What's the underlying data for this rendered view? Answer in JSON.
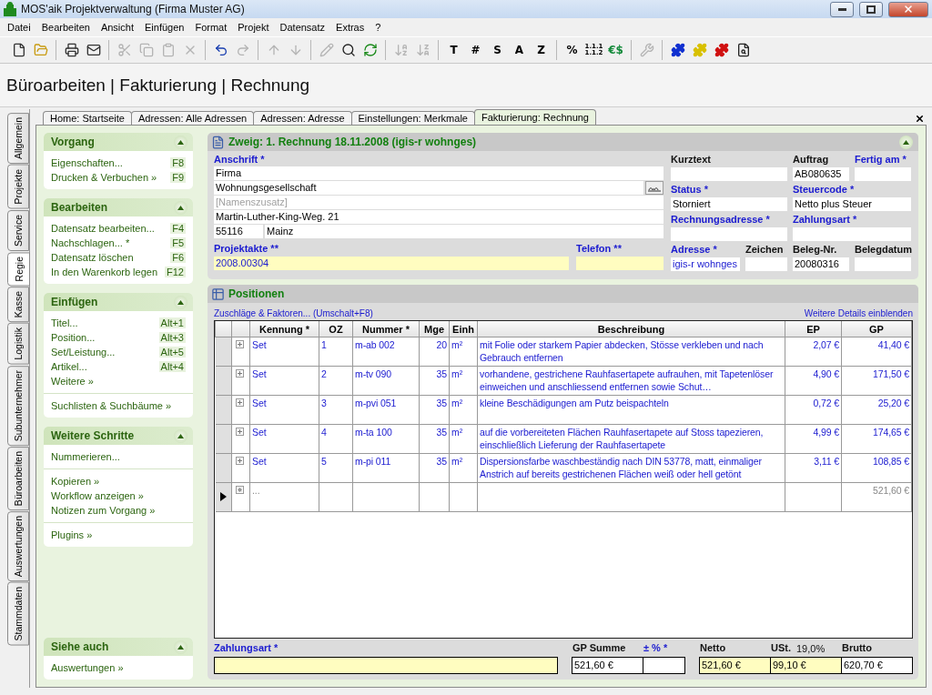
{
  "window": {
    "title": "MOS'aik Projektverwaltung (Firma Muster AG)"
  },
  "menu": [
    "Datei",
    "Bearbeiten",
    "Ansicht",
    "Einfügen",
    "Format",
    "Projekt",
    "Datensatz",
    "Extras",
    "?"
  ],
  "toolbar": [
    [
      {
        "kind": "icon",
        "disabled": false
      },
      {
        "kind": "icon",
        "disabled": false
      }
    ],
    [
      {
        "kind": "icon",
        "disabled": false
      },
      {
        "kind": "icon",
        "disabled": false
      }
    ],
    [
      {
        "kind": "icon",
        "disabled": true
      },
      {
        "kind": "icon",
        "disabled": true
      },
      {
        "kind": "icon",
        "disabled": true
      },
      {
        "kind": "icon",
        "disabled": true
      }
    ],
    [
      {
        "kind": "icon",
        "disabled": false
      },
      {
        "kind": "icon",
        "disabled": true
      }
    ],
    [
      {
        "kind": "icon",
        "disabled": true
      },
      {
        "kind": "icon",
        "disabled": true
      }
    ],
    [
      {
        "kind": "icon",
        "disabled": true
      },
      {
        "kind": "icon",
        "disabled": false
      },
      {
        "kind": "icon",
        "disabled": false
      }
    ],
    [
      {
        "kind": "icon",
        "disabled": true
      },
      {
        "kind": "icon",
        "disabled": true
      }
    ],
    [
      {
        "kind": "text",
        "label": "T"
      },
      {
        "kind": "text",
        "label": "#"
      },
      {
        "kind": "text",
        "label": "S"
      },
      {
        "kind": "text",
        "label": "A"
      },
      {
        "kind": "text",
        "label": "Z"
      }
    ],
    [
      {
        "kind": "text",
        "label": "%"
      },
      {
        "kind": "text",
        "label": "1.1.1\n1.1.2"
      },
      {
        "kind": "text",
        "label": "€$"
      }
    ],
    [
      {
        "kind": "icon",
        "disabled": true
      }
    ],
    [
      {
        "kind": "icon",
        "disabled": false
      },
      {
        "kind": "icon",
        "disabled": false
      },
      {
        "kind": "icon",
        "disabled": false
      },
      {
        "kind": "icon",
        "disabled": false
      }
    ]
  ],
  "page_title": "Büroarbeiten | Fakturierung | Rechnung",
  "side_tabs": [
    {
      "label": "Allgemein",
      "selected": false
    },
    {
      "label": "Projekte",
      "selected": false
    },
    {
      "label": "Service",
      "selected": false
    },
    {
      "label": "Regie",
      "selected": true
    },
    {
      "label": "Kasse",
      "selected": false
    },
    {
      "label": "Logistik",
      "selected": false
    },
    {
      "label": "Subunternehmer",
      "selected": false
    },
    {
      "label": "Büroarbeiten",
      "selected": false
    },
    {
      "label": "Auswertungen",
      "selected": false
    },
    {
      "label": "Stammdaten",
      "selected": false
    }
  ],
  "doc_tabs": [
    {
      "label": "Home: Startseite",
      "selected": false
    },
    {
      "label": "Adressen: Alle Adressen",
      "selected": false
    },
    {
      "label": "Adressen: Adresse",
      "selected": false
    },
    {
      "label": "Einstellungen: Merkmale",
      "selected": false
    },
    {
      "label": "Fakturierung: Rechnung",
      "selected": true
    }
  ],
  "task_panel": {
    "sections": [
      {
        "title": "Vorgang",
        "groups": [
          [
            {
              "label": "Eigenschaften...",
              "shortcut": "F8"
            },
            {
              "label": "Drucken & Verbuchen »",
              "shortcut": "F9"
            }
          ]
        ]
      },
      {
        "title": "Bearbeiten",
        "groups": [
          [
            {
              "label": "Datensatz bearbeiten...",
              "shortcut": "F4"
            },
            {
              "label": "Nachschlagen... *",
              "shortcut": "F5"
            },
            {
              "label": "Datensatz löschen",
              "shortcut": "F6"
            },
            {
              "label": "In den Warenkorb legen",
              "shortcut": "F12"
            }
          ]
        ]
      },
      {
        "title": "Einfügen",
        "groups": [
          [
            {
              "label": "Titel...",
              "shortcut": "Alt+1"
            },
            {
              "label": "Position...",
              "shortcut": "Alt+3"
            },
            {
              "label": "Set/Leistung...",
              "shortcut": "Alt+5"
            },
            {
              "label": "Artikel...",
              "shortcut": "Alt+4"
            },
            {
              "label": "Weitere »"
            }
          ],
          [
            {
              "label": "Suchlisten & Suchbäume »"
            }
          ]
        ]
      },
      {
        "title": "Weitere Schritte",
        "groups": [
          [
            {
              "label": "Nummerieren..."
            }
          ],
          [
            {
              "label": "Kopieren »"
            },
            {
              "label": "Workflow anzeigen »"
            },
            {
              "label": "Notizen zum Vorgang »"
            }
          ],
          [
            {
              "label": "Plugins »"
            }
          ]
        ]
      }
    ],
    "see_also": {
      "title": "Siehe auch",
      "groups": [
        [
          {
            "label": "Auswertungen »"
          }
        ]
      ]
    }
  },
  "invoice": {
    "title": "Zweig: 1. Rechnung 18.11.2008 (igis-r wohnges)",
    "address": {
      "label": "Anschrift *",
      "required": true,
      "lines": [
        {
          "kind": "text",
          "value": "Firma"
        },
        {
          "kind": "lookup",
          "value": "Wohnungsgesellschaft"
        },
        {
          "kind": "text",
          "placeholder": "[Namenszusatz]"
        },
        {
          "kind": "text",
          "value": "Martin-Luther-King-Weg. 21"
        },
        {
          "kind": "city",
          "zip": "55116",
          "city": "Mainz"
        }
      ]
    },
    "lower_fields": [
      {
        "label": "Projektakte **",
        "required": true,
        "value": "2008.00304",
        "highlighted": true,
        "link": true
      },
      {
        "label": "Telefon **",
        "required": true,
        "highlighted": true,
        "link": false
      }
    ],
    "right_rows": [
      [
        {
          "label": "Kurztext",
          "required": false
        },
        {
          "label": "Auftrag",
          "required": false,
          "value": "AB080635"
        },
        {
          "label": "Fertig am *",
          "required": true
        }
      ],
      [
        {
          "label": "Status *",
          "required": true,
          "value": "Storniert"
        },
        {
          "label": "Steuercode *",
          "required": true,
          "value": "Netto plus Steuer"
        }
      ],
      [
        {
          "label": "Rechnungsadresse *",
          "required": true
        },
        {
          "label": "Zahlungsart *",
          "required": true
        }
      ],
      [
        {
          "label": "Adresse *",
          "required": true,
          "value": "igis-r wohnges",
          "link": true
        },
        {
          "label": "Zeichen",
          "required": false
        },
        {
          "label": "Beleg-Nr.",
          "required": false,
          "value": "20080316"
        },
        {
          "label": "Belegdatum",
          "required": false
        }
      ]
    ]
  },
  "positions": {
    "title": "Positionen",
    "left_link": "Zuschläge & Faktoren... (Umschalt+F8)",
    "right_link": "Weitere Details einblenden",
    "columns": [
      "Kennung *",
      "OZ",
      "Nummer *",
      "Mge",
      "Einh",
      "Beschreibung",
      "EP",
      "GP"
    ],
    "rows": [
      {
        "kind": "position",
        "current": false,
        "cells": [
          "Set",
          "1",
          "m-ab 002",
          "20",
          "m²",
          "mit Folie oder starkem Papier abdecken, Stösse verkleben und nach Gebrauch entfernen",
          "2,07 €",
          "41,40 €"
        ]
      },
      {
        "kind": "position",
        "current": false,
        "cells": [
          "Set",
          "2",
          "m-tv 090",
          "35",
          "m²",
          "vorhandene, gestrichene Rauhfasertapete aufrauhen, mit Tapetenlöser einweichen und anschliessend entfernen sowie Schut…",
          "4,90 €",
          "171,50 €"
        ]
      },
      {
        "kind": "position",
        "current": false,
        "cells": [
          "Set",
          "3",
          "m-pvi 051",
          "35",
          "m²",
          "kleine Beschädigungen am Putz beispachteln",
          "0,72 €",
          "25,20 €"
        ]
      },
      {
        "kind": "position",
        "current": false,
        "cells": [
          "Set",
          "4",
          "m-ta 100",
          "35",
          "m²",
          "auf die vorbereiteten Flächen Rauhfasertapete auf Stoss tapezieren, einschließlich Lieferung der Rauhfasertapete",
          "4,99 €",
          "174,65 €"
        ]
      },
      {
        "kind": "position",
        "current": false,
        "cells": [
          "Set",
          "5",
          "m-pi 011",
          "35",
          "m²",
          "Dispersionsfarbe waschbeständig nach DIN 53778, matt, einmaliger Anstrich auf bereits gestrichenen Flächen weiß oder hell getönt",
          "3,11 €",
          "108,85 €"
        ]
      },
      {
        "kind": "new",
        "current": true,
        "placeholder": "...",
        "total": "521,60 €"
      }
    ]
  },
  "footer": {
    "payment": {
      "label": "Zahlungsart *",
      "required": true,
      "highlighted": true
    },
    "groups": [
      [
        {
          "label": "GP Summe",
          "required": false,
          "value": "521,60 €",
          "highlighted": false
        },
        {
          "label": "± % *",
          "required": true,
          "highlighted": false
        }
      ],
      [
        {
          "label": "Netto",
          "required": false,
          "value": "521,60 €",
          "highlighted": true
        },
        {
          "label": "USt.",
          "rate": "19,0%",
          "required": false,
          "value": "99,10 €",
          "highlighted": true
        },
        {
          "label": "Brutto",
          "required": false,
          "value": "620,70 €",
          "highlighted": false
        }
      ]
    ]
  }
}
